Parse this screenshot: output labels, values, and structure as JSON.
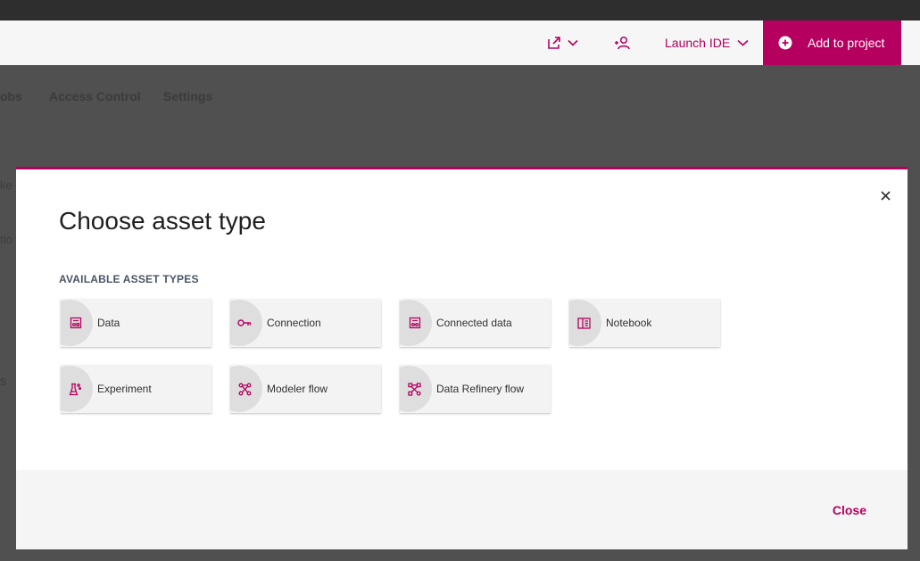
{
  "header": {
    "export_icon": "export-icon",
    "collaborator_icon": "add-collaborator-icon",
    "launch_ide_label": "Launch IDE",
    "add_to_project_label": "Add to project"
  },
  "background": {
    "tabs": [
      "obs",
      "Access Control",
      "Settings"
    ],
    "fragments": [
      "ke",
      "tio",
      "s"
    ]
  },
  "modal": {
    "title": "Choose asset type",
    "section_label": "AVAILABLE ASSET TYPES",
    "asset_types": [
      {
        "label": "Data",
        "icon": "data-icon"
      },
      {
        "label": "Connection",
        "icon": "connection-icon"
      },
      {
        "label": "Connected data",
        "icon": "connected-data-icon"
      },
      {
        "label": "Notebook",
        "icon": "notebook-icon"
      },
      {
        "label": "Experiment",
        "icon": "experiment-icon"
      },
      {
        "label": "Modeler flow",
        "icon": "modeler-flow-icon"
      },
      {
        "label": "Data Refinery flow",
        "icon": "data-refinery-flow-icon"
      }
    ],
    "close_label": "Close"
  },
  "colors": {
    "accent": "#b6005f",
    "overlay": "#505050",
    "tile_bg": "#f3f3f3"
  }
}
